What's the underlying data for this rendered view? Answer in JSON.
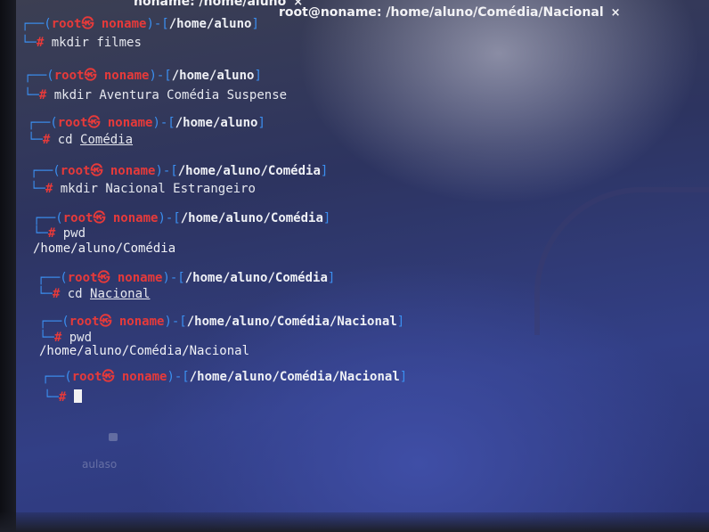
{
  "tabs": [
    {
      "label": "noname: /home/aluno",
      "close": "×"
    },
    {
      "label": "root@noname: /home/aluno/Comédia/Nacional",
      "close": "×"
    }
  ],
  "terminal": {
    "prompt": {
      "open": "┌──(",
      "user": "root",
      "at": "㉿",
      "host": "noname",
      "sep": ")-[",
      "close": "]",
      "prefix2": "└─",
      "hash": "#"
    },
    "entries": [
      {
        "path": "/home/aluno",
        "command": "mkdir",
        "args": "filmes",
        "output": ""
      },
      {
        "path": "/home/aluno",
        "command": "mkdir",
        "args": "Aventura Comédia Suspense",
        "output": ""
      },
      {
        "path": "/home/aluno",
        "command": "cd",
        "args": "Comédia",
        "output": ""
      },
      {
        "path": "/home/aluno/Comédia",
        "command": "mkdir",
        "args": "Nacional Estrangeiro",
        "output": ""
      },
      {
        "path": "/home/aluno/Comédia",
        "command": "pwd",
        "args": "",
        "output": "/home/aluno/Comédia"
      },
      {
        "path": "/home/aluno/Comédia",
        "command": "cd",
        "args": "Nacional",
        "output": ""
      },
      {
        "path": "/home/aluno/Comédia/Nacional",
        "command": "pwd",
        "args": "",
        "output": "/home/aluno/Comédia/Nacional"
      },
      {
        "path": "/home/aluno/Comédia/Nacional",
        "command": "",
        "args": "",
        "output": ""
      }
    ]
  },
  "desktop_icon": {
    "label": "aulaso"
  }
}
